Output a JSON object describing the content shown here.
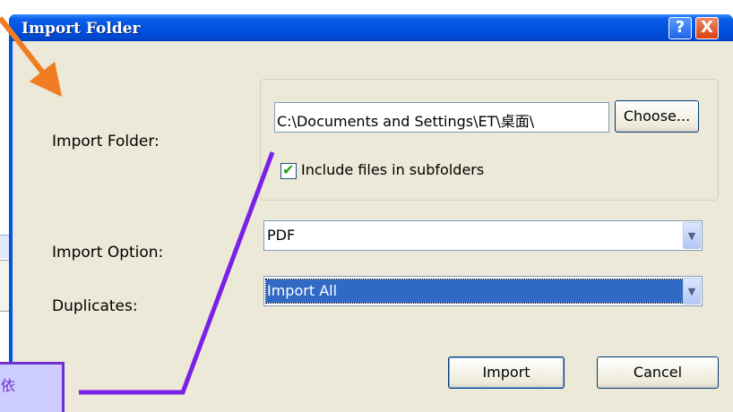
{
  "window": {
    "title": "Import Folder",
    "help_label": "?",
    "close_label": "X"
  },
  "form": {
    "folder_label": "Import Folder:",
    "folder_path": "C:\\Documents and Settings\\ET\\桌面\\",
    "choose_label": "Choose...",
    "include_subfolders_label": "Include files in subfolders",
    "include_subfolders_checked": true,
    "option_label": "Import Option:",
    "option_value": "PDF",
    "duplicates_label": "Duplicates:",
    "duplicates_value": "Import All"
  },
  "buttons": {
    "import_label": "Import",
    "cancel_label": "Cancel"
  },
  "annotation": {
    "callout_text": "依"
  },
  "icons": {
    "checkbox": "check-icon",
    "dropdown": "chevron-down-icon"
  },
  "colors": {
    "titlebar": "#0054e3",
    "arrow_orange": "#f07d22",
    "callout_purple": "#7030d0",
    "selection_blue": "#316ac5"
  }
}
